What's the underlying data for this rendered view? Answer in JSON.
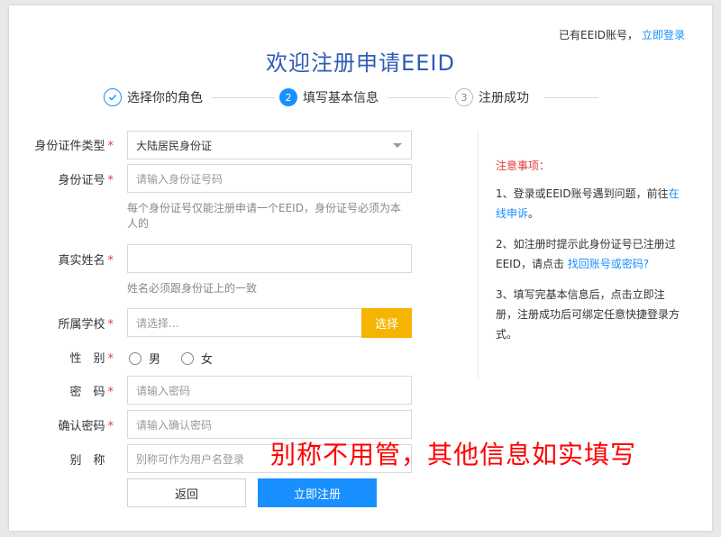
{
  "header": {
    "have_account": "已有EEID账号，",
    "login_link": "立即登录",
    "title": "欢迎注册申请EEID"
  },
  "steps": [
    {
      "num": "✓",
      "label": "选择你的角色"
    },
    {
      "num": "2",
      "label": "填写基本信息"
    },
    {
      "num": "3",
      "label": "注册成功"
    }
  ],
  "form": {
    "id_type": {
      "label": "身份证件类型",
      "value": "大陆居民身份证"
    },
    "id_number": {
      "label": "身份证号",
      "placeholder": "请输入身份证号码",
      "hint": "每个身份证号仅能注册申请一个EEID，身份证号必须为本人的"
    },
    "real_name": {
      "label": "真实姓名",
      "placeholder": "",
      "hint": "姓名必须跟身份证上的一致"
    },
    "school": {
      "label": "所属学校",
      "placeholder": "请选择...",
      "button": "选择"
    },
    "gender": {
      "label": "性　别",
      "options": [
        "男",
        "女"
      ]
    },
    "password": {
      "label": "密　码",
      "placeholder": "请输入密码"
    },
    "confirm_password": {
      "label": "确认密码",
      "placeholder": "请输入确认密码"
    },
    "nickname": {
      "label": "别　称",
      "placeholder": "别称可作为用户名登录"
    },
    "back_button": "返回",
    "submit_button": "立即注册"
  },
  "notice": {
    "title": "注意事项：",
    "item1_text": "1、登录或EEID账号遇到问题，前往",
    "item1_link": "在线申诉",
    "item1_end": "。",
    "item2_text": "2、如注册时提示此身份证号已注册过EEID，请点击",
    "item2_link": "找回账号或密码?",
    "item3_text": "3、填写完基本信息后，点击立即注册，注册成功后可绑定任意快捷登录方式。"
  },
  "annotation": "别称不用管，其他信息如实填写",
  "colors": {
    "accent": "#1890ff",
    "title": "#2f5bb7",
    "warning": "#e4393c",
    "select_button": "#f5b400",
    "annotation": "#ff0000"
  }
}
